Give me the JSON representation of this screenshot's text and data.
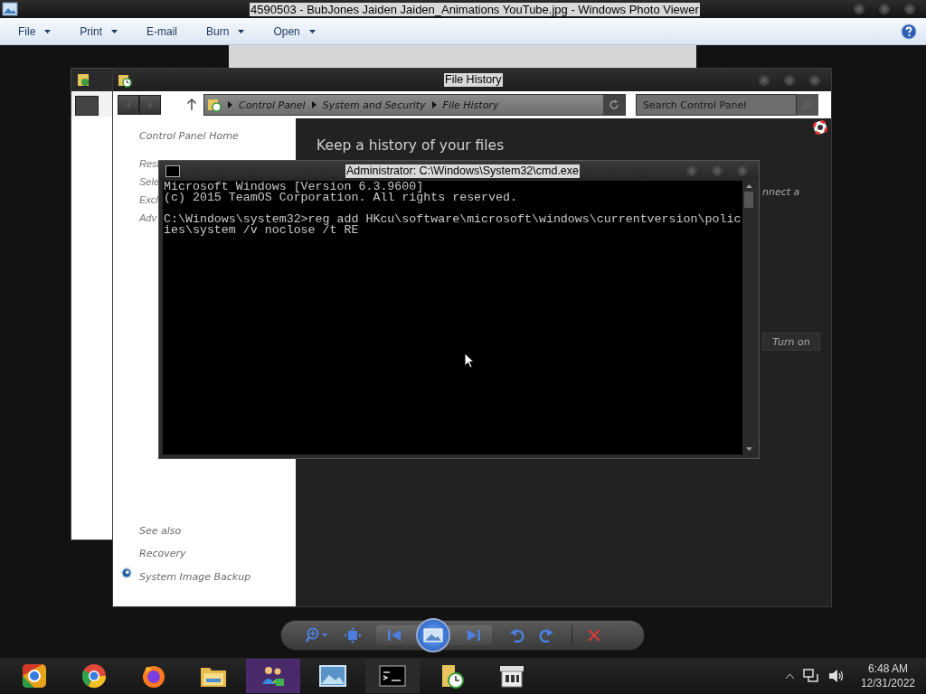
{
  "viewer": {
    "title": "4590503 - BubJones Jaiden Jaiden_Animations YouTube.jpg - Windows Photo Viewer",
    "menu": [
      {
        "label": "File",
        "dropdown": true
      },
      {
        "label": "Print",
        "dropdown": true
      },
      {
        "label": "E-mail",
        "dropdown": false
      },
      {
        "label": "Burn",
        "dropdown": true
      },
      {
        "label": "Open",
        "dropdown": true
      }
    ]
  },
  "file_history": {
    "title": "File History",
    "breadcrumb": [
      "Control Panel",
      "System and Security",
      "File History"
    ],
    "search": {
      "placeholder": "Search Control Panel"
    },
    "sidebar": {
      "home": "Control Panel Home",
      "tasks": [
        "Rest",
        "Sele",
        "Excl",
        "Adv"
      ],
      "see_also_heading": "See also",
      "see_also": [
        {
          "label": "Recovery",
          "icon": false
        },
        {
          "label": "System Image Backup",
          "icon": true
        }
      ]
    },
    "heading": "Keep a history of your files",
    "text_fragment": "nnect a",
    "button": "Turn on"
  },
  "cmd": {
    "title": "Administrator: C:\\Windows\\System32\\cmd.exe",
    "blocks": [
      [
        "Microsoft Windows [Version 6.3.9600]",
        "(c) 2015 TeamOS Corporation. All rights reserved."
      ],
      [
        "C:\\Windows\\system32>reg add HKcu\\software\\microsoft\\windows\\currentversion\\polic",
        "ies\\system /v noclose /t RE"
      ]
    ]
  },
  "taskbar": {
    "time": "6:48 AM",
    "date": "12/31/2022"
  }
}
